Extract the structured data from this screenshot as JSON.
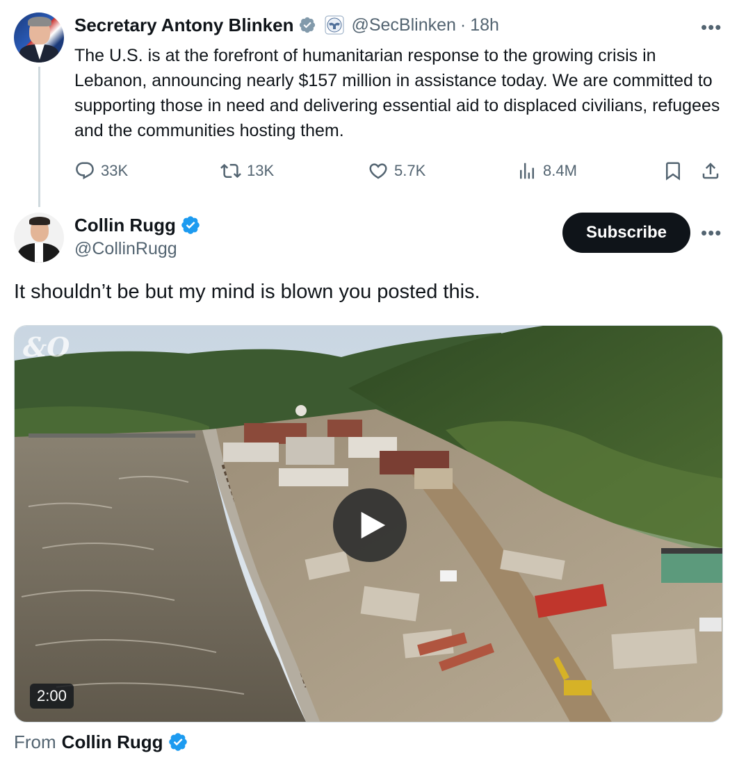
{
  "parent_tweet": {
    "author_name": "Secretary Antony Blinken",
    "handle": "@SecBlinken",
    "separator": "·",
    "time": "18h",
    "more_label": "•••",
    "text": "The U.S. is at the forefront of humanitarian response to the growing crisis in Lebanon, announcing nearly $157 million in assistance today. We are committed to supporting those in need and delivering essential aid to displaced civilians, refugees and the communities hosting them.",
    "stats": {
      "replies": "33K",
      "reposts": "13K",
      "likes": "5.7K",
      "views": "8.4M"
    }
  },
  "main_tweet": {
    "author_name": "Collin Rugg",
    "handle": "@CollinRugg",
    "subscribe_label": "Subscribe",
    "more_label": "•••",
    "text": "It shouldn’t be but my mind is blown you posted this.",
    "video": {
      "watermark": "&O",
      "duration": "2:00"
    },
    "from_label": "From",
    "from_name": "Collin Rugg"
  },
  "colors": {
    "text_primary": "#0f1419",
    "text_secondary": "#536471",
    "verified_blue": "#1d9bf0",
    "government_gray": "#829aab",
    "thread_line": "#cfd9de",
    "button_dark": "#0f1419"
  }
}
